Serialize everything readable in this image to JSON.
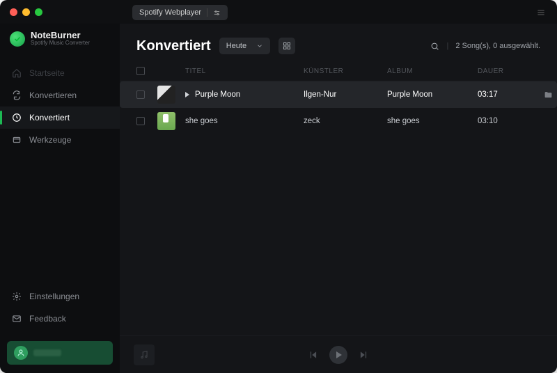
{
  "app": {
    "name": "NoteBurner",
    "subtitle": "Spotify Music Converter",
    "top_source": "Spotify Webplayer"
  },
  "sidebar": {
    "items": [
      {
        "label": "Startseite",
        "icon": "home"
      },
      {
        "label": "Konvertieren",
        "icon": "convert"
      },
      {
        "label": "Konvertiert",
        "icon": "clock"
      },
      {
        "label": "Werkzeuge",
        "icon": "tools"
      }
    ],
    "bottom": [
      {
        "label": "Einstellungen",
        "icon": "gear"
      },
      {
        "label": "Feedback",
        "icon": "mail"
      }
    ]
  },
  "page": {
    "title": "Konvertiert",
    "filter": "Heute",
    "status": "2 Song(s), 0 ausgewählt."
  },
  "table": {
    "headers": {
      "title": "TITEL",
      "artist": "KÜNSTLER",
      "album": "ALBUM",
      "duration": "DAUER"
    },
    "rows": [
      {
        "title": "Purple Moon",
        "artist": "Ilgen-Nur",
        "album": "Purple Moon",
        "duration": "03:17",
        "active": true
      },
      {
        "title": "she goes",
        "artist": "zeck",
        "album": "she goes",
        "duration": "03:10",
        "active": false
      }
    ]
  }
}
